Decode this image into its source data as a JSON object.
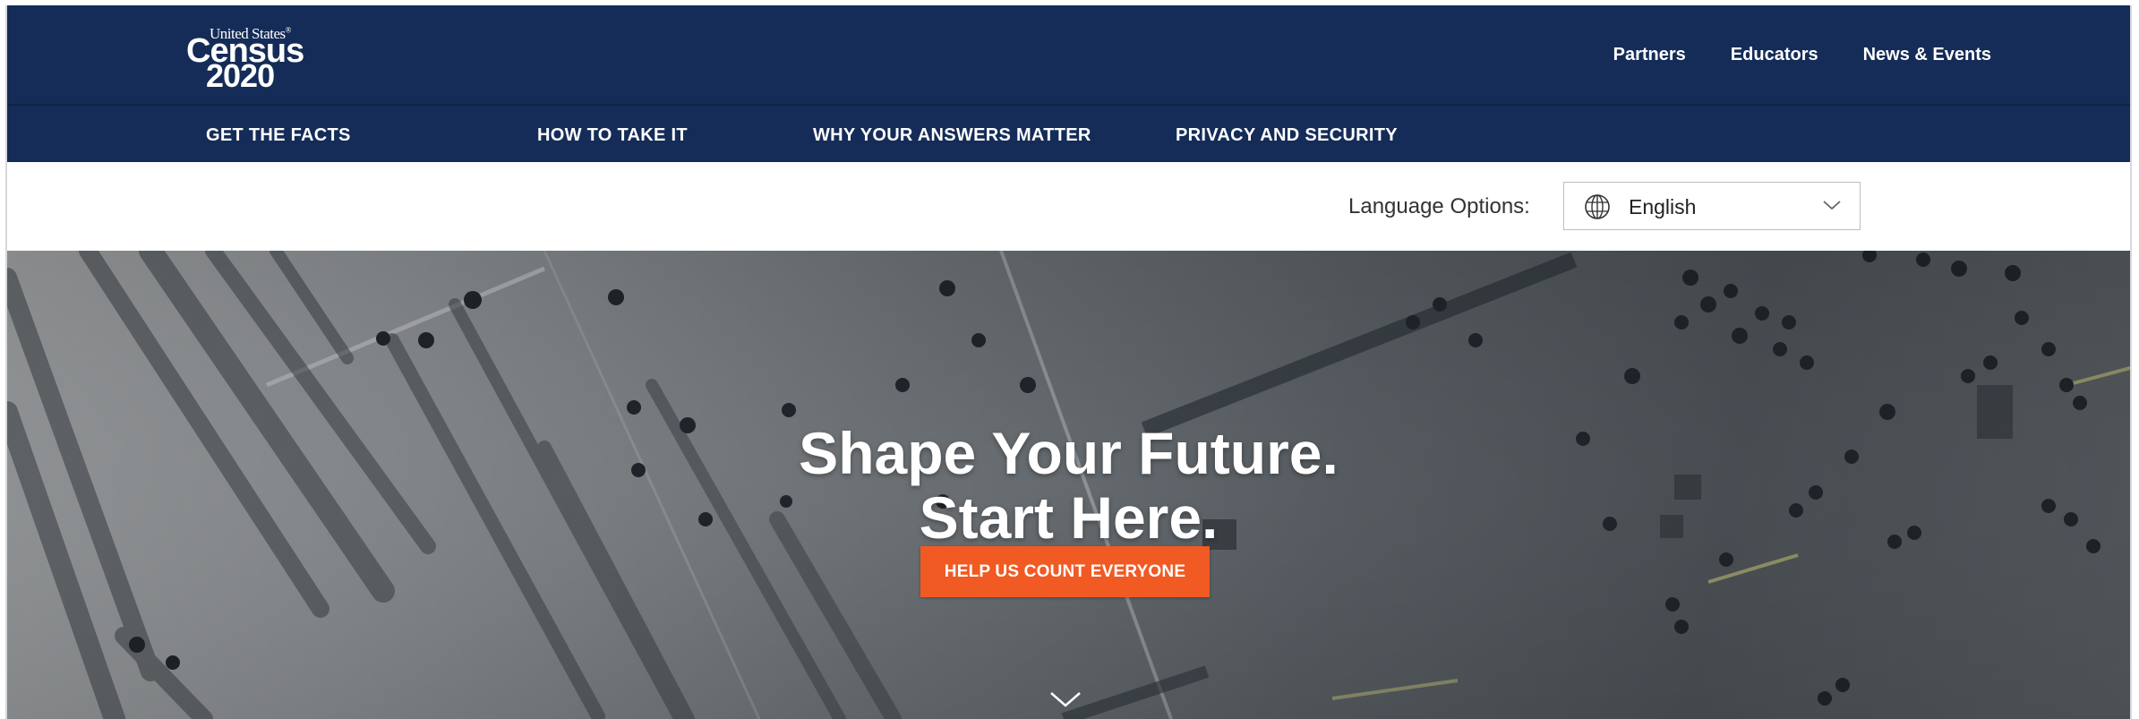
{
  "logo": {
    "line1": "United States",
    "trademark": "®",
    "line2": "Census",
    "line3": "2020"
  },
  "util_nav": [
    {
      "label": "Partners"
    },
    {
      "label": "Educators"
    },
    {
      "label": "News & Events"
    }
  ],
  "main_nav": [
    {
      "label": "GET THE FACTS"
    },
    {
      "label": "HOW TO TAKE IT"
    },
    {
      "label": "WHY YOUR ANSWERS MATTER"
    },
    {
      "label": "PRIVACY AND SECURITY"
    }
  ],
  "language": {
    "label": "Language Options:",
    "selected": "English",
    "icon": "globe-icon",
    "dropdown_icon": "chevron-down-icon"
  },
  "hero": {
    "title_line1": "Shape Your Future.",
    "title_line2": "Start Here.",
    "cta": "HELP US COUNT EVERYONE",
    "scroll_icon": "chevron-down-icon"
  },
  "colors": {
    "navy": "#142c57",
    "cta_orange": "#f15a22",
    "white": "#ffffff"
  }
}
